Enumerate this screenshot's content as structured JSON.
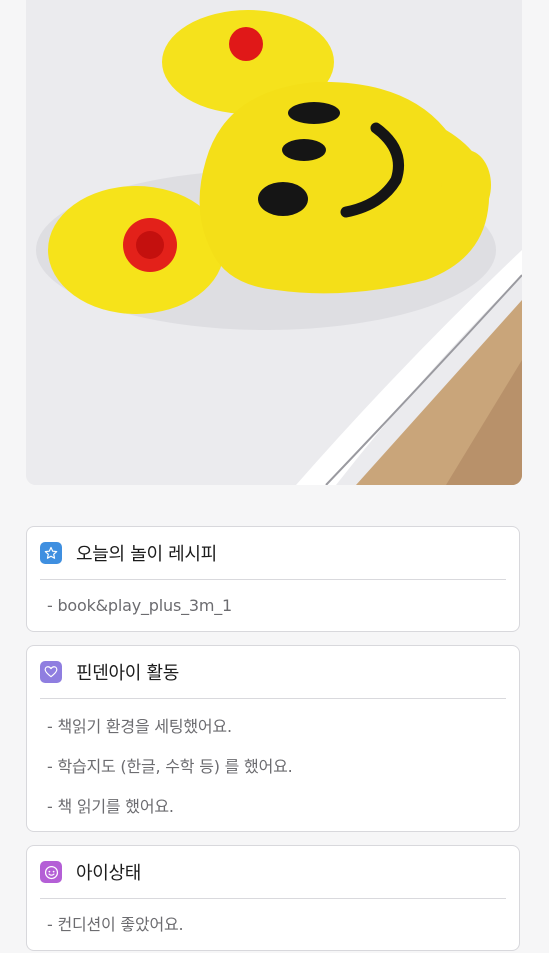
{
  "photo": {
    "alt": ""
  },
  "cards": [
    {
      "title": "오늘의 놀이 레시피",
      "icon": "star-icon",
      "color": "#3f8fe0",
      "lines": [
        "- book&play_plus_3m_1"
      ]
    },
    {
      "title": "핀덴아이 활동",
      "icon": "heart-icon",
      "color": "#8f7ee0",
      "lines": [
        "- 책읽기 환경을 세팅했어요.",
        "- 학습지도 (한글, 수학 등) 를 했어요.",
        "- 책 읽기를 했어요."
      ]
    },
    {
      "title": "아이상태",
      "icon": "smile-face-icon",
      "color": "#b45fd6",
      "lines": [
        "- 컨디션이 좋았어요."
      ]
    }
  ]
}
